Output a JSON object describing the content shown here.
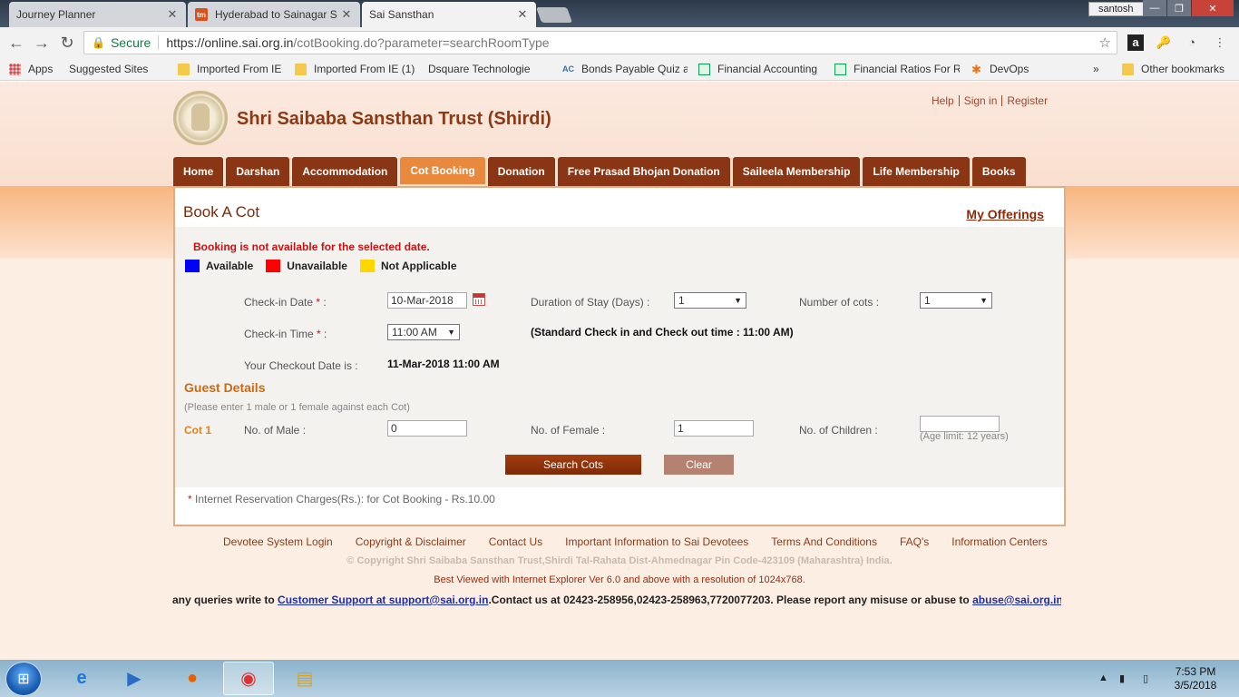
{
  "browser": {
    "tabs": [
      {
        "title": "Journey Planner",
        "active": false,
        "icon": "page-icon"
      },
      {
        "title": "Hyderabad to Sainagar S",
        "active": false,
        "icon": "tm-icon"
      },
      {
        "title": "Sai Sansthan",
        "active": true,
        "icon": "page-icon"
      }
    ],
    "user": "santosh",
    "secure_label": "Secure",
    "url_host": "https://online.sai.org.in",
    "url_path": "/cotBooking.do?parameter=searchRoomType",
    "bookmarks": [
      {
        "label": "Apps",
        "icon": "apps-grid-icon"
      },
      {
        "label": "Suggested Sites",
        "icon": "page-icon"
      },
      {
        "label": "Imported From IE",
        "icon": "folder-icon"
      },
      {
        "label": "Imported From IE (1)",
        "icon": "folder-icon"
      },
      {
        "label": "Dsquare Technologie",
        "icon": "page-icon"
      },
      {
        "label": "Bonds Payable Quiz a",
        "icon": "ac-icon"
      },
      {
        "label": "Financial Accounting",
        "icon": "sheet-icon"
      },
      {
        "label": "Financial Ratios For R",
        "icon": "sheet-icon"
      },
      {
        "label": "DevOps",
        "icon": "devops-icon"
      },
      {
        "label": "»",
        "icon": ""
      },
      {
        "label": "Other bookmarks",
        "icon": "folder-icon"
      }
    ]
  },
  "site": {
    "title": "Shri Saibaba Sansthan Trust (Shirdi)",
    "toplinks": [
      "Help",
      "Sign in",
      "Register"
    ],
    "nav": [
      "Home",
      "Darshan",
      "Accommodation",
      "Cot Booking",
      "Donation",
      "Free Prasad Bhojan Donation",
      "Saileela Membership",
      "Life Membership",
      "Books"
    ],
    "nav_active": "Cot Booking"
  },
  "booking": {
    "heading": "Book A Cot",
    "my_offerings": "My Offerings",
    "error": "Booking is not available for the selected date.",
    "legend": [
      {
        "label": "Available",
        "color": "#0000ff"
      },
      {
        "label": "Unavailable",
        "color": "#ff0000"
      },
      {
        "label": "Not Applicable",
        "color": "#ffd700"
      }
    ],
    "checkin_date_label": "Check-in Date",
    "checkin_date_value": "10-Mar-2018",
    "duration_label": "Duration of Stay (Days) :",
    "duration_value": "1",
    "num_cots_label": "Number of cots :",
    "num_cots_value": "1",
    "checkin_time_label": "Check-in Time",
    "checkin_time_value": "11:00 AM",
    "standard_note": "(Standard Check in and Check out time : 11:00 AM)",
    "checkout_label": "Your Checkout Date is :",
    "checkout_value": "11-Mar-2018 11:00 AM",
    "required_mark": "*",
    "colon": " :",
    "guest_title": "Guest Details",
    "guest_note": "(Please enter 1 male or 1 female against each Cot)",
    "cot_label": "Cot 1",
    "male_label": "No. of Male :",
    "male_value": "0",
    "female_label": "No. of Female :",
    "female_value": "1",
    "children_label": "No. of Children :",
    "children_value": "",
    "age_limit": "(Age limit: 12 years)",
    "search_button": "Search Cots",
    "clear_button": "Clear",
    "charges": "Internet Reservation Charges(Rs.):  for Cot Booking - Rs.10.00"
  },
  "footer": {
    "links": [
      "Devotee System Login",
      "Copyright & Disclaimer",
      "Contact Us",
      "Important Information to Sai Devotees",
      "Terms And Conditions",
      "FAQ's",
      "Information Centers"
    ],
    "copyright": "© Copyright Shri Saibaba Sansthan Trust,Shirdi Tal-Rahata Dist-Ahmednagar Pin Code-423109 (Maharashtra) India.",
    "bestview": "Best Viewed with Internet Explorer Ver 6.0 and above with a resolution of 1024x768.",
    "queries_prefix": "any queries write to",
    "customer_support": "Customer Support at support@sai.org.in",
    "queries_middle": ".Contact us at 02423-258956,02423-258963,7720077203. Please report any misuse or abuse to",
    "abuse_email": "abuse@sai.org.in"
  },
  "taskbar": {
    "time": "7:53 PM",
    "date": "3/5/2018"
  }
}
